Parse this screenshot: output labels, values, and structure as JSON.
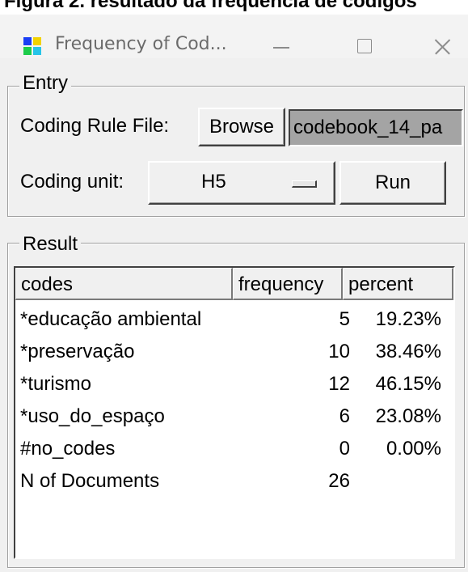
{
  "caption": "Figura 2. resultado da frequência de códigos",
  "window": {
    "title": "Frequency of Cod...",
    "icon_colors": [
      "#1a3ef5",
      "#f2d200",
      "#1dcc4b",
      "#27c4e8"
    ]
  },
  "entry": {
    "group_label": "Entry",
    "coding_rule_file_label": "Coding Rule File:",
    "browse_label": "Browse",
    "file_value": "codebook_14_pa",
    "coding_unit_label": "Coding unit:",
    "coding_unit_value": "H5",
    "run_label": "Run"
  },
  "result": {
    "group_label": "Result",
    "columns": [
      "codes",
      "frequency",
      "percent"
    ],
    "rows": [
      {
        "code": "*educação ambiental",
        "frequency": "5",
        "percent": "19.23%"
      },
      {
        "code": "*preservação",
        "frequency": "10",
        "percent": "38.46%"
      },
      {
        "code": "*turismo",
        "frequency": "12",
        "percent": "46.15%"
      },
      {
        "code": "*uso_do_espaço",
        "frequency": "6",
        "percent": "23.08%"
      },
      {
        "code": "#no_codes",
        "frequency": "0",
        "percent": "0.00%"
      },
      {
        "code": "N of Documents",
        "frequency": "26",
        "percent": ""
      }
    ]
  }
}
